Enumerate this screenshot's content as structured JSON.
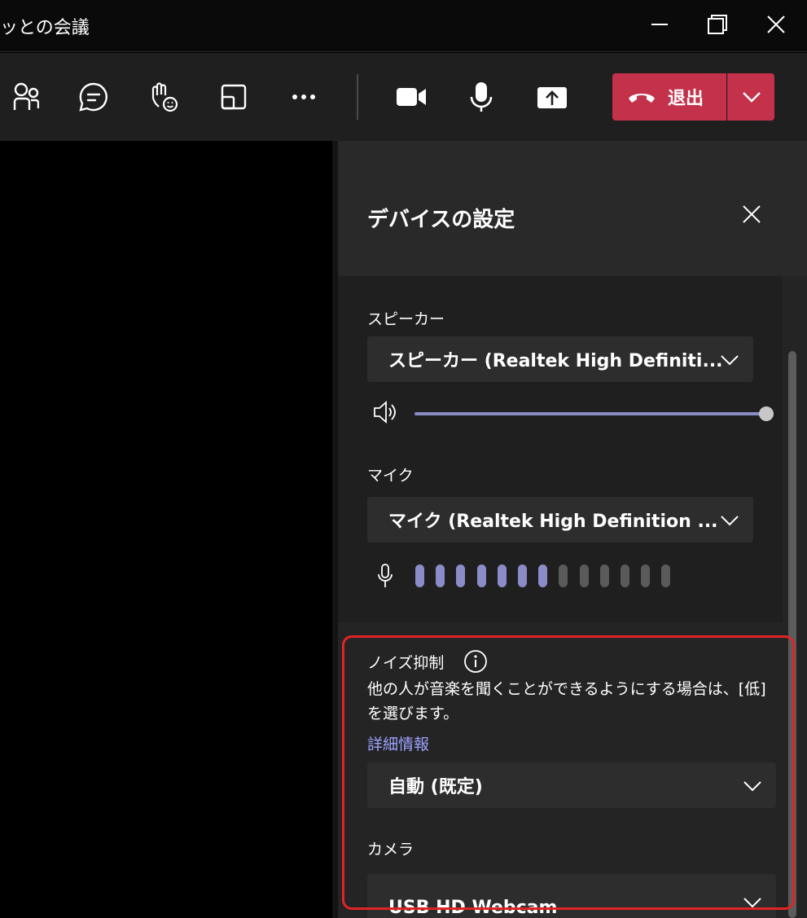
{
  "window": {
    "title": "ッとの会議",
    "controls": [
      "minimize",
      "maximize",
      "close"
    ]
  },
  "toolbar": {
    "buttons": [
      {
        "icon": "people-icon"
      },
      {
        "icon": "chat-icon"
      },
      {
        "icon": "raise-hand-icon"
      },
      {
        "icon": "rooms-icon"
      },
      {
        "icon": "more-icon"
      },
      {
        "icon": "camera-icon"
      },
      {
        "icon": "mic-icon"
      },
      {
        "icon": "share-icon"
      }
    ],
    "leave_label": "退出",
    "leave_color": "#c4314b"
  },
  "panel": {
    "title": "デバイスの設定",
    "speaker": {
      "label": "スピーカー",
      "value": "スピーカー (Realtek High Definiti...",
      "volume": 1.0
    },
    "mic": {
      "label": "マイク",
      "value": "マイク (Realtek High Definition ...",
      "level_bars_total": 13,
      "level_bars_active": 7
    },
    "noise": {
      "label": "ノイズ抑制",
      "description": "他の人が音楽を聞くことができるようにする場合は、[低] を選びます。",
      "link": "詳細情報",
      "value": "自動 (既定)"
    },
    "camera": {
      "label": "カメラ",
      "value": "USB HD Webcam"
    }
  },
  "colors": {
    "accent": "#8b8cc7",
    "link": "#9ea2ff",
    "highlight": "#e02424"
  }
}
